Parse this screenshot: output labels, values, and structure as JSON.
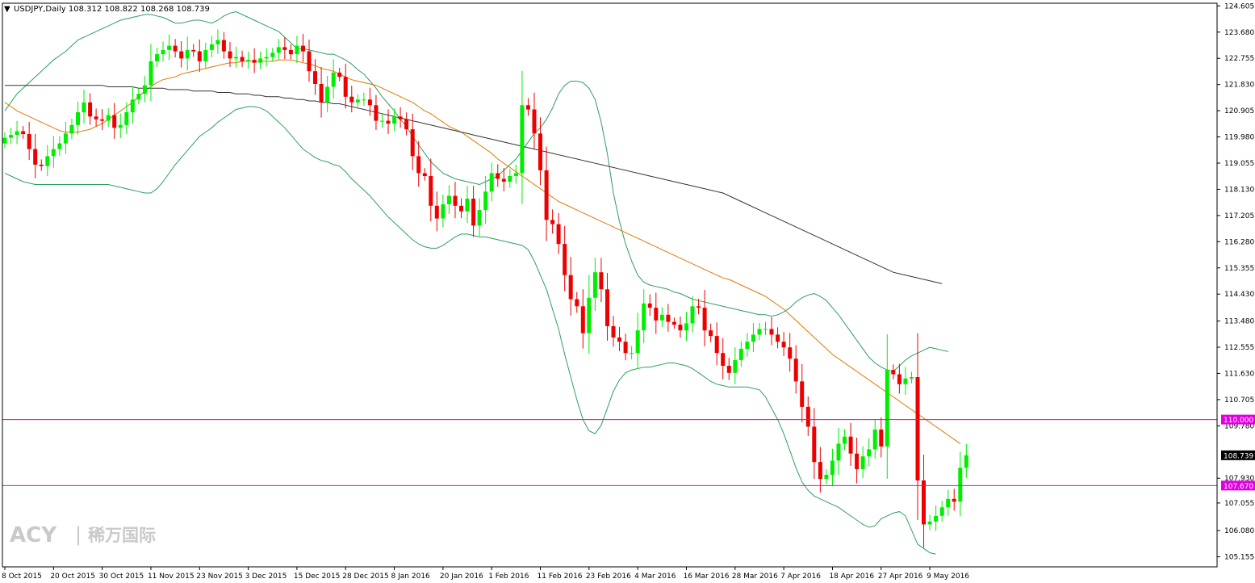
{
  "header": {
    "arrow": "▼",
    "text": "USDJPY,Daily  108.312 108.822 108.268 108.739"
  },
  "watermark": {
    "brand": "ACY",
    "sep": "|",
    "cn": "稀万国际"
  },
  "colors": {
    "background": "#ffffff",
    "bull": "#00ee00",
    "bear": "#ee0000",
    "bollinger": "#2e9e5e",
    "ma_mid": "#e07800",
    "ma_long": "#333333",
    "hline": "#e000e0",
    "axis": "#000000"
  },
  "chart_data": {
    "type": "candlestick",
    "symbol": "USDJPY",
    "timeframe": "Daily",
    "ohlc_current": {
      "open": 108.312,
      "high": 108.822,
      "low": 108.268,
      "close": 108.739
    },
    "ylim": [
      104.8,
      124.7
    ],
    "y_ticks": [
      "124.605",
      "123.680",
      "122.755",
      "121.830",
      "120.905",
      "119.980",
      "119.055",
      "118.130",
      "117.205",
      "116.280",
      "115.355",
      "114.430",
      "113.480",
      "112.555",
      "111.630",
      "110.705",
      "109.780",
      "107.930",
      "107.055",
      "106.080",
      "105.155"
    ],
    "x_tick_labels": [
      "8 Oct 2015",
      "20 Oct 2015",
      "30 Oct 2015",
      "11 Nov 2015",
      "23 Nov 2015",
      "3 Dec 2015",
      "15 Dec 2015",
      "28 Dec 2015",
      "8 Jan 2016",
      "20 Jan 2016",
      "1 Feb 2016",
      "11 Feb 2016",
      "23 Feb 2016",
      "4 Mar 2016",
      "16 Mar 2016",
      "28 Mar 2016",
      "7 Apr 2016",
      "18 Apr 2016",
      "27 Apr 2016",
      "9 May 2016"
    ],
    "x_tick_bar_index": [
      0,
      8,
      16,
      24,
      32,
      40,
      48,
      56,
      64,
      72,
      80,
      88,
      96,
      104,
      112,
      120,
      128,
      136,
      144,
      152
    ],
    "horizontal_lines": [
      {
        "value": 110.0,
        "label": "110.000"
      },
      {
        "value": 107.67,
        "label": "107.670"
      }
    ],
    "price_label": "108.739",
    "price_value": 108.739,
    "closes": [
      119.95,
      120.05,
      120.18,
      120.08,
      119.55,
      119.0,
      118.95,
      119.3,
      119.55,
      119.75,
      120.1,
      120.4,
      120.85,
      121.2,
      120.7,
      120.6,
      120.55,
      120.75,
      120.3,
      120.4,
      120.85,
      121.3,
      121.5,
      121.8,
      122.65,
      122.9,
      123.05,
      123.2,
      123.0,
      122.75,
      123.05,
      123.0,
      122.65,
      123.05,
      123.25,
      123.4,
      123.0,
      122.75,
      122.8,
      122.65,
      122.7,
      122.6,
      122.75,
      122.8,
      122.95,
      123.15,
      123.05,
      122.9,
      123.2,
      123.0,
      122.3,
      121.85,
      121.2,
      121.75,
      122.25,
      122.1,
      121.4,
      121.2,
      121.3,
      121.3,
      121.1,
      120.55,
      120.55,
      120.45,
      120.7,
      120.6,
      120.25,
      119.3,
      118.7,
      118.6,
      117.55,
      117.1,
      117.6,
      117.9,
      117.55,
      117.35,
      117.8,
      116.85,
      117.4,
      118.05,
      118.7,
      118.5,
      118.4,
      118.6,
      118.7,
      121.1,
      120.95,
      120.1,
      118.8,
      117.05,
      116.9,
      116.2,
      115.1,
      114.25,
      114.0,
      113.05,
      114.3,
      115.2,
      114.6,
      113.3,
      112.9,
      112.75,
      112.35,
      112.35,
      113.15,
      114.1,
      113.95,
      113.5,
      113.7,
      113.45,
      113.35,
      113.15,
      113.4,
      114.0,
      113.95,
      113.15,
      112.95,
      112.35,
      111.9,
      111.65,
      112.1,
      112.5,
      112.75,
      113.0,
      113.2,
      113.2,
      113.0,
      112.75,
      112.55,
      112.15,
      111.35,
      110.45,
      109.75,
      108.5,
      107.9,
      108.05,
      108.55,
      109.15,
      109.4,
      108.8,
      108.25,
      108.7,
      108.95,
      109.65,
      109.05,
      111.75,
      111.6,
      111.25,
      111.45,
      111.5,
      107.85,
      106.3,
      106.4,
      106.6,
      106.9,
      107.2,
      107.1,
      108.3,
      108.74
    ],
    "bb_upper": [
      120.9,
      121.2,
      121.5,
      121.7,
      121.9,
      122.1,
      122.3,
      122.5,
      122.7,
      122.85,
      123.0,
      123.2,
      123.4,
      123.5,
      123.6,
      123.7,
      123.8,
      123.9,
      124.0,
      124.1,
      124.15,
      124.2,
      124.25,
      124.3,
      124.3,
      124.25,
      124.2,
      124.1,
      124.0,
      124.0,
      124.05,
      124.1,
      124.1,
      124.05,
      124.0,
      124.1,
      124.25,
      124.35,
      124.4,
      124.3,
      124.2,
      124.1,
      124.0,
      123.9,
      123.8,
      123.7,
      123.5,
      123.3,
      123.1,
      123.1,
      123.05,
      123.0,
      122.95,
      122.9,
      122.9,
      122.8,
      122.7,
      122.55,
      122.35,
      122.2,
      121.95,
      121.7,
      121.4,
      121.15,
      120.9,
      120.6,
      120.35,
      120.0,
      119.7,
      119.4,
      119.1,
      118.9,
      118.7,
      118.6,
      118.5,
      118.45,
      118.4,
      118.35,
      118.3,
      118.4,
      118.5,
      118.6,
      118.8,
      119.0,
      119.2,
      119.5,
      119.8,
      120.1,
      120.3,
      120.6,
      121.0,
      121.5,
      121.8,
      121.95,
      121.95,
      121.9,
      121.7,
      121.3,
      120.5,
      119.4,
      118.0,
      117.0,
      116.2,
      115.6,
      115.1,
      114.85,
      114.75,
      114.7,
      114.65,
      114.6,
      114.5,
      114.45,
      114.35,
      114.25,
      114.2,
      114.15,
      114.1,
      114.05,
      114.0,
      113.95,
      113.9,
      113.85,
      113.8,
      113.75,
      113.7,
      113.7,
      113.65,
      113.7,
      113.8,
      113.95,
      114.15,
      114.3,
      114.4,
      114.45,
      114.35,
      114.2,
      113.95,
      113.7,
      113.4,
      113.1,
      112.8,
      112.5,
      112.2,
      112.0,
      111.85,
      111.75,
      111.7,
      111.9,
      112.1,
      112.25,
      112.35,
      112.45,
      112.55,
      112.5,
      112.45,
      112.4
    ],
    "bb_lower": [
      118.7,
      118.6,
      118.5,
      118.4,
      118.35,
      118.3,
      118.3,
      118.3,
      118.3,
      118.3,
      118.3,
      118.3,
      118.3,
      118.3,
      118.3,
      118.3,
      118.3,
      118.3,
      118.25,
      118.2,
      118.15,
      118.1,
      118.05,
      118.0,
      118.0,
      118.15,
      118.4,
      118.7,
      119.0,
      119.25,
      119.5,
      119.75,
      120.0,
      120.15,
      120.3,
      120.5,
      120.65,
      120.8,
      120.95,
      121.0,
      121.05,
      121.05,
      121.0,
      120.9,
      120.7,
      120.5,
      120.3,
      120.05,
      119.8,
      119.55,
      119.4,
      119.25,
      119.15,
      119.1,
      119.0,
      118.95,
      118.75,
      118.5,
      118.3,
      118.1,
      117.9,
      117.65,
      117.4,
      117.15,
      116.95,
      116.75,
      116.55,
      116.35,
      116.2,
      116.1,
      116.05,
      116.05,
      116.15,
      116.3,
      116.45,
      116.55,
      116.55,
      116.5,
      116.45,
      116.45,
      116.4,
      116.35,
      116.3,
      116.25,
      116.2,
      116.15,
      116.0,
      115.6,
      115.1,
      114.6,
      113.9,
      113.2,
      112.3,
      111.5,
      110.7,
      110.0,
      109.6,
      109.5,
      109.8,
      110.4,
      111.0,
      111.4,
      111.65,
      111.75,
      111.8,
      111.85,
      111.85,
      111.9,
      111.95,
      112.0,
      112.0,
      111.95,
      111.9,
      111.8,
      111.65,
      111.5,
      111.35,
      111.25,
      111.2,
      111.15,
      111.15,
      111.15,
      111.15,
      111.1,
      111.05,
      110.8,
      110.4,
      110.0,
      109.5,
      108.9,
      108.3,
      107.8,
      107.5,
      107.3,
      107.2,
      107.1,
      107.0,
      106.9,
      106.75,
      106.6,
      106.45,
      106.3,
      106.2,
      106.25,
      106.5,
      106.6,
      106.7,
      106.75,
      106.6,
      106.1,
      105.6,
      105.45,
      105.3,
      105.25
    ],
    "ma_mid": [
      121.2,
      121.05,
      120.9,
      120.8,
      120.7,
      120.6,
      120.5,
      120.4,
      120.3,
      120.2,
      120.15,
      120.15,
      120.15,
      120.2,
      120.25,
      120.35,
      120.45,
      120.6,
      120.75,
      120.9,
      121.05,
      121.2,
      121.4,
      121.6,
      121.75,
      121.9,
      122.0,
      122.05,
      122.1,
      122.2,
      122.25,
      122.3,
      122.35,
      122.4,
      122.45,
      122.5,
      122.55,
      122.6,
      122.6,
      122.65,
      122.65,
      122.65,
      122.65,
      122.65,
      122.65,
      122.7,
      122.7,
      122.7,
      122.65,
      122.6,
      122.55,
      122.5,
      122.4,
      122.35,
      122.3,
      122.2,
      122.1,
      122.0,
      121.95,
      121.9,
      121.85,
      121.8,
      121.7,
      121.6,
      121.5,
      121.4,
      121.3,
      121.2,
      121.05,
      120.9,
      120.8,
      120.65,
      120.5,
      120.35,
      120.25,
      120.15,
      120.0,
      119.85,
      119.7,
      119.55,
      119.4,
      119.2,
      119.05,
      118.9,
      118.75,
      118.6,
      118.45,
      118.3,
      118.15,
      118.0,
      117.85,
      117.7,
      117.6,
      117.5,
      117.4,
      117.3,
      117.2,
      117.1,
      117.0,
      116.9,
      116.8,
      116.7,
      116.6,
      116.5,
      116.4,
      116.3,
      116.2,
      116.1,
      116.0,
      115.9,
      115.8,
      115.7,
      115.6,
      115.5,
      115.4,
      115.3,
      115.2,
      115.1,
      115.0,
      114.95,
      114.85,
      114.75,
      114.65,
      114.55,
      114.45,
      114.35,
      114.2,
      114.05,
      113.9,
      113.7,
      113.5,
      113.3,
      113.1,
      112.9,
      112.7,
      112.5,
      112.3,
      112.15,
      112.0,
      111.85,
      111.7,
      111.55,
      111.4,
      111.25,
      111.1,
      110.95,
      110.8,
      110.65,
      110.5,
      110.35,
      110.2,
      110.05,
      109.9,
      109.75,
      109.6,
      109.45,
      109.3,
      109.15
    ],
    "ma_long": [
      121.8,
      121.8,
      121.8,
      121.8,
      121.8,
      121.8,
      121.8,
      121.8,
      121.8,
      121.8,
      121.8,
      121.8,
      121.8,
      121.8,
      121.8,
      121.8,
      121.8,
      121.75,
      121.75,
      121.75,
      121.75,
      121.75,
      121.7,
      121.7,
      121.7,
      121.7,
      121.7,
      121.65,
      121.65,
      121.65,
      121.65,
      121.6,
      121.6,
      121.6,
      121.6,
      121.55,
      121.55,
      121.55,
      121.5,
      121.5,
      121.5,
      121.45,
      121.45,
      121.4,
      121.4,
      121.4,
      121.35,
      121.35,
      121.3,
      121.3,
      121.25,
      121.25,
      121.2,
      121.2,
      121.15,
      121.15,
      121.1,
      121.05,
      121.0,
      120.95,
      120.9,
      120.85,
      120.8,
      120.75,
      120.7,
      120.65,
      120.6,
      120.55,
      120.5,
      120.45,
      120.4,
      120.35,
      120.3,
      120.25,
      120.2,
      120.15,
      120.1,
      120.05,
      120.0,
      119.95,
      119.9,
      119.85,
      119.8,
      119.75,
      119.7,
      119.65,
      119.6,
      119.55,
      119.5,
      119.45,
      119.4,
      119.35,
      119.3,
      119.25,
      119.2,
      119.15,
      119.1,
      119.05,
      119.0,
      118.95,
      118.9,
      118.85,
      118.8,
      118.75,
      118.7,
      118.65,
      118.6,
      118.55,
      118.5,
      118.45,
      118.4,
      118.35,
      118.3,
      118.25,
      118.2,
      118.15,
      118.1,
      118.05,
      118.0,
      117.9,
      117.8,
      117.7,
      117.6,
      117.5,
      117.4,
      117.3,
      117.2,
      117.1,
      117.0,
      116.9,
      116.8,
      116.7,
      116.6,
      116.5,
      116.4,
      116.3,
      116.2,
      116.1,
      116.0,
      115.9,
      115.8,
      115.7,
      115.6,
      115.5,
      115.4,
      115.3,
      115.2,
      115.15,
      115.1,
      115.05,
      115.0,
      114.95,
      114.9,
      114.85,
      114.8
    ]
  }
}
